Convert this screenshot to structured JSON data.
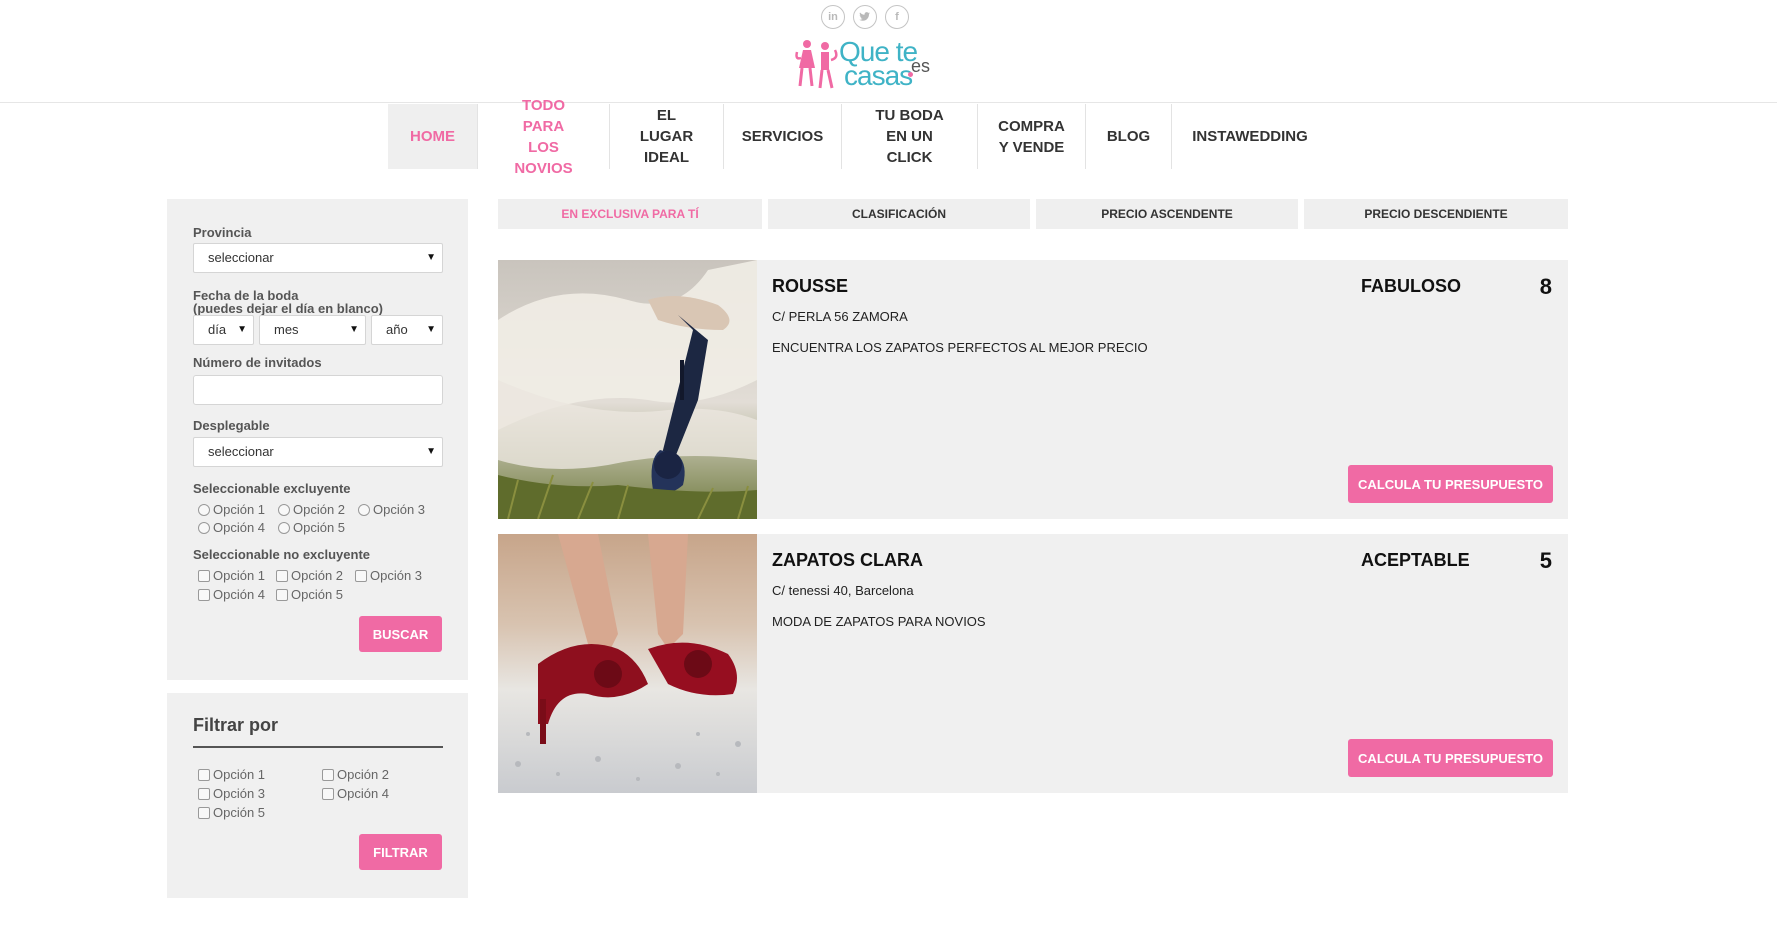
{
  "social": {
    "linkedin": "in",
    "twitter": "t",
    "facebook": "f"
  },
  "logo": {
    "line1": "Que te",
    "line2": "casas",
    "tld": "es"
  },
  "nav": [
    {
      "label": "HOME",
      "state": "active"
    },
    {
      "label": "TODO PARA\nLOS NOVIOS",
      "state": "highlighted"
    },
    {
      "label": "EL LUGAR\nIDEAL"
    },
    {
      "label": "SERVICIOS"
    },
    {
      "label": "TU BODA\nEN UN CLICK"
    },
    {
      "label": "COMPRA\nY VENDE"
    },
    {
      "label": "BLOG"
    },
    {
      "label": "INSTAWEDDING"
    }
  ],
  "search": {
    "provincia_label": "Provincia",
    "provincia_value": "seleccionar",
    "fecha_label": "Fecha de la boda",
    "fecha_hint": "(puedes dejar el día en blanco)",
    "dia": "día",
    "mes": "mes",
    "anio": "año",
    "invitados_label": "Número de invitados",
    "invitados_value": "",
    "desplegable_label": "Desplegable",
    "desplegable_value": "seleccionar",
    "excluyente_label": "Seleccionable excluyente",
    "excluyente_options": [
      "Opción 1",
      "Opción 2",
      "Opción 3",
      "Opción 4",
      "Opción 5"
    ],
    "no_excluyente_label": "Seleccionable no excluyente",
    "no_excluyente_options": [
      "Opción 1",
      "Opción 2",
      "Opción 3",
      "Opción 4",
      "Opción 5"
    ],
    "buscar_label": "BUSCAR"
  },
  "filter": {
    "title": "Filtrar por",
    "options": [
      "Opción 1",
      "Opción 2",
      "Opción 3",
      "Opción 4",
      "Opción 5"
    ],
    "button_label": "FILTRAR"
  },
  "sort_tabs": [
    {
      "label": "EN EXCLUSIVA PARA TÍ",
      "active": true
    },
    {
      "label": "CLASIFICACIÓN"
    },
    {
      "label": "PRECIO ASCENDENTE"
    },
    {
      "label": "PRECIO DESCENDIENTE"
    }
  ],
  "listings": [
    {
      "name": "ROUSSE",
      "address": "C/ PERLA 56 ZAMORA",
      "description": "ENCUENTRA LOS ZAPATOS PERFECTOS AL MEJOR PRECIO",
      "rating": "FABULOSO",
      "score": "8",
      "cta": "CALCULA TU PRESUPUESTO"
    },
    {
      "name": "ZAPATOS CLARA",
      "address": "C/ tenessi 40, Barcelona",
      "description": "MODA DE ZAPATOS PARA NOVIOS",
      "rating": "ACEPTABLE",
      "score": "5",
      "cta": "CALCULA TU PRESUPUESTO"
    }
  ],
  "colors": {
    "accent": "#f06aa4",
    "logo_blue": "#3fb3c6",
    "panel_bg": "#f0f0f0"
  }
}
